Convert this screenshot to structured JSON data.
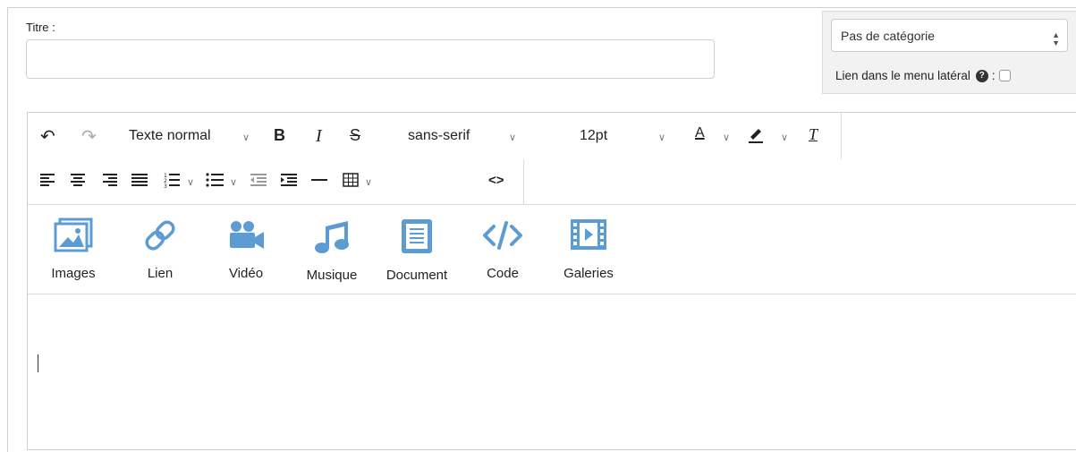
{
  "form": {
    "title_label": "Titre :",
    "title_value": "",
    "category_selected": "Pas de catégorie",
    "menu_link_label": "Lien dans le menu latéral",
    "menu_link_suffix": ":",
    "help_glyph": "?",
    "menu_link_checked": false
  },
  "toolbar": {
    "undo_icon": "↶",
    "redo_icon": "↷",
    "block_format": "Texte normal",
    "bold": "B",
    "italic": "I",
    "strike": "S",
    "font_family": "sans-serif",
    "font_size": "12pt",
    "text_color_letter": "A",
    "clear_format": "T",
    "chevron": "∨",
    "code_icon": "<>"
  },
  "media": {
    "accent_color": "#5d9cd3",
    "items": [
      {
        "label": "Images",
        "icon": "image-icon"
      },
      {
        "label": "Lien",
        "icon": "link-icon"
      },
      {
        "label": "Vidéo",
        "icon": "video-camera-icon"
      },
      {
        "label": "Musique",
        "icon": "music-note-icon"
      },
      {
        "label": "Document",
        "icon": "document-icon"
      },
      {
        "label": "Code",
        "icon": "code-icon"
      },
      {
        "label": "Galeries",
        "icon": "film-strip-icon"
      }
    ]
  },
  "editor": {
    "content": ""
  }
}
